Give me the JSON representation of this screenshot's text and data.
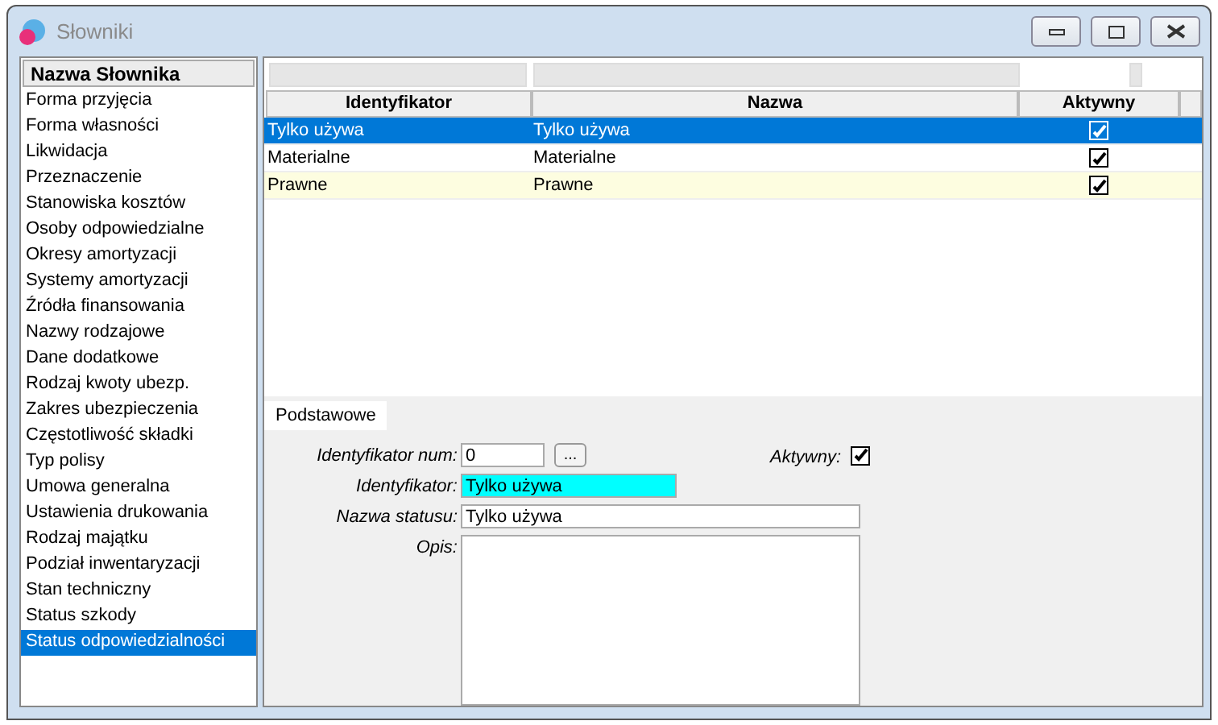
{
  "window": {
    "title": "Słowniki"
  },
  "dictionary_list": {
    "header": "Nazwa Słownika",
    "items": [
      {
        "label": "Forma przyjęcia",
        "selected": false
      },
      {
        "label": "Forma własności",
        "selected": false
      },
      {
        "label": "Likwidacja",
        "selected": false
      },
      {
        "label": "Przeznaczenie",
        "selected": false
      },
      {
        "label": "Stanowiska kosztów",
        "selected": false
      },
      {
        "label": "Osoby odpowiedzialne",
        "selected": false
      },
      {
        "label": "Okresy amortyzacji",
        "selected": false
      },
      {
        "label": "Systemy amortyzacji",
        "selected": false
      },
      {
        "label": "Źródła finansowania",
        "selected": false
      },
      {
        "label": "Nazwy rodzajowe",
        "selected": false
      },
      {
        "label": "Dane dodatkowe",
        "selected": false
      },
      {
        "label": "Rodzaj kwoty ubezp.",
        "selected": false
      },
      {
        "label": "Zakres ubezpieczenia",
        "selected": false
      },
      {
        "label": "Częstotliwość składki",
        "selected": false
      },
      {
        "label": "Typ polisy",
        "selected": false
      },
      {
        "label": "Umowa generalna",
        "selected": false
      },
      {
        "label": "Ustawienia drukowania",
        "selected": false
      },
      {
        "label": "Rodzaj majątku",
        "selected": false
      },
      {
        "label": "Podział inwentaryzacji",
        "selected": false
      },
      {
        "label": "Stan techniczny",
        "selected": false
      },
      {
        "label": "Status szkody",
        "selected": false
      },
      {
        "label": "Status odpowiedzialności",
        "selected": true
      }
    ]
  },
  "table": {
    "columns": [
      "Identyfikator",
      "Nazwa",
      "Aktywny"
    ],
    "rows": [
      {
        "identyfikator": "Tylko używa",
        "nazwa": "Tylko używa",
        "aktywny": true,
        "selected": true
      },
      {
        "identyfikator": "Materialne",
        "nazwa": "Materialne",
        "aktywny": true,
        "selected": false
      },
      {
        "identyfikator": "Prawne",
        "nazwa": "Prawne",
        "aktywny": true,
        "selected": false
      }
    ]
  },
  "tabs": [
    {
      "label": "Podstawowe",
      "selected": true
    }
  ],
  "form": {
    "identyfikator_num": {
      "label": "Identyfikator num:",
      "value": "0",
      "button": "..."
    },
    "aktywny": {
      "label": "Aktywny:",
      "checked": true
    },
    "identyfikator": {
      "label": "Identyfikator:",
      "value": "Tylko używa"
    },
    "nazwa_statusu": {
      "label": "Nazwa statusu:",
      "value": "Tylko używa"
    },
    "opis": {
      "label": "Opis:"
    }
  }
}
